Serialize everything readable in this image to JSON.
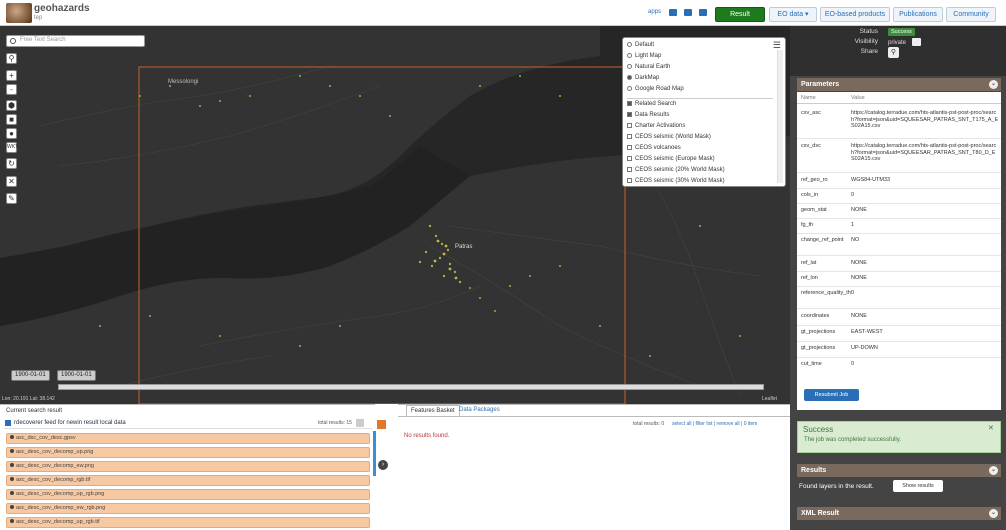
{
  "header": {
    "brand": "geohazards",
    "brand_sub": "tep",
    "apps_label": "apps",
    "result_button": "Result",
    "nav": [
      "EO data ▾",
      "EO-based products",
      "Publications",
      "Community"
    ]
  },
  "map": {
    "search_placeholder": "Free Text Search",
    "tools": [
      "+",
      "-"
    ],
    "layer_panel": {
      "base_maps": [
        {
          "label": "Default",
          "selected": false
        },
        {
          "label": "Light Map",
          "selected": false
        },
        {
          "label": "Natural Earth",
          "selected": false
        },
        {
          "label": "DarkMap",
          "selected": true
        },
        {
          "label": "Google Road Map",
          "selected": false
        }
      ],
      "overlays": [
        {
          "label": "Related Search",
          "checked": true
        },
        {
          "label": "Data Results",
          "checked": true
        },
        {
          "label": "Charter Activations",
          "checked": false
        },
        {
          "label": "CEOS seismic (World Mask)",
          "checked": false
        },
        {
          "label": "CEOS volcanoes",
          "checked": false
        },
        {
          "label": "CEOS seismic (Europe Mask)",
          "checked": false
        },
        {
          "label": "CEOS seismic (20% World Mask)",
          "checked": false
        },
        {
          "label": "CEOS seismic (30% World Mask)",
          "checked": false
        }
      ]
    },
    "place_labels": [
      "Messolongi",
      "Patras"
    ],
    "date_start": "1900-01-01",
    "date_end": "1900-01-01",
    "coords": "Lon: 20.191 Lat: 38.142",
    "attribution": "Leaflet"
  },
  "left_results": {
    "title": "Current search result",
    "header": "rdecoverer feed for newin result local data",
    "total": "total results: 15",
    "rows": [
      "asc_dsc_cov_desc.gpsv",
      "asc_desc_cov_decomp_up.png",
      "asc_desc_cov_decomp_ew.png",
      "asc_desc_cov_decomp_rgb.tif",
      "asc_desc_cov_decomp_up_rgb.png",
      "asc_desc_cov_decomp_ew_rgb.png",
      "asc_desc_cov_decomp_up_rgb.tif"
    ]
  },
  "middle": {
    "tabs": [
      "Features Basket",
      "Data Packages"
    ],
    "total": "total results: 0",
    "actions": "select all | filter list | remove all | 0 item",
    "no_results": "No results found."
  },
  "right_panel": {
    "status_label": "Status",
    "status_value": "Success",
    "visibility_label": "Visibility",
    "visibility_value": "private",
    "share_label": "Share",
    "parameters_title": "Parameters",
    "col_name": "Name",
    "col_value": "Value",
    "params": [
      {
        "name": "csv_asc",
        "value": "https://catalog.terradue.com/hts-atlantis-pst-post-proc/search?format=json&uid=SQUEESAR_PATRAS_SNT_T175_A_ES02A15.csv"
      },
      {
        "name": "csv_dsc",
        "value": "https://catalog.terradue.com/hts-atlantis-pst-post-proc/search?format=json&uid=SQUEESAR_PATRAS_SNT_T80_D_ES02A15.csv"
      },
      {
        "name": "ref_geo_ro",
        "value": "WGS84-UTM33"
      },
      {
        "name": "cols_in",
        "value": "0"
      },
      {
        "name": "geom_stat",
        "value": "NONE"
      },
      {
        "name": "fg_th",
        "value": "1"
      },
      {
        "name": "change_ref_point",
        "value": "NO"
      },
      {
        "name": "ref_lat",
        "value": "NONE"
      },
      {
        "name": "ref_lon",
        "value": "NONE"
      },
      {
        "name": "reference_quality_th",
        "value": "0"
      },
      {
        "name": "coordinates",
        "value": "NONE"
      },
      {
        "name": "gt_projections",
        "value": "EAST-WEST"
      },
      {
        "name": "gt_projections",
        "value": "UP-DOWN"
      },
      {
        "name": "cut_time",
        "value": "0"
      }
    ],
    "resubmit": "Resubmit Job",
    "success_title": "Success",
    "success_text": "The job was completed successfully.",
    "results_title": "Results",
    "found_label": "Found layers in the result.",
    "show_button": "Show results",
    "xml_title": "XML Result"
  }
}
